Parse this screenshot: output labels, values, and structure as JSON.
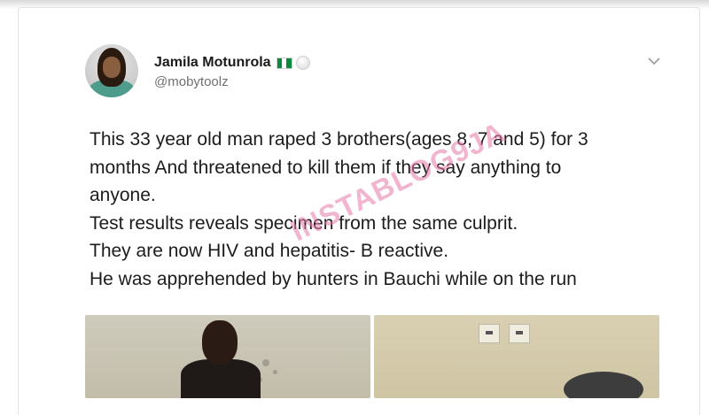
{
  "tweet": {
    "author": {
      "name": "Jamila Motunrola",
      "handle": "@mobytoolz",
      "flag_icon": "nigeria-flag-icon",
      "flag_colors": [
        "#0b8a3e",
        "#ffffff",
        "#0b8a3e"
      ]
    },
    "menu_icon": "chevron-down-icon",
    "lines": [
      "This 33 year old man raped 3 brothers(ages 8, 7 and 5) for 3",
      "months And threatened to kill them if they say anything to",
      "anyone.",
      "Test results reveals specimen from the same culprit.",
      "They are now HIV and hepatitis- B reactive.",
      "He was apprehended  by hunters in Bauchi while on the run"
    ],
    "media_count": 2
  },
  "watermark": {
    "text": "INSTABLOG9JA",
    "color": "#e878aa"
  }
}
